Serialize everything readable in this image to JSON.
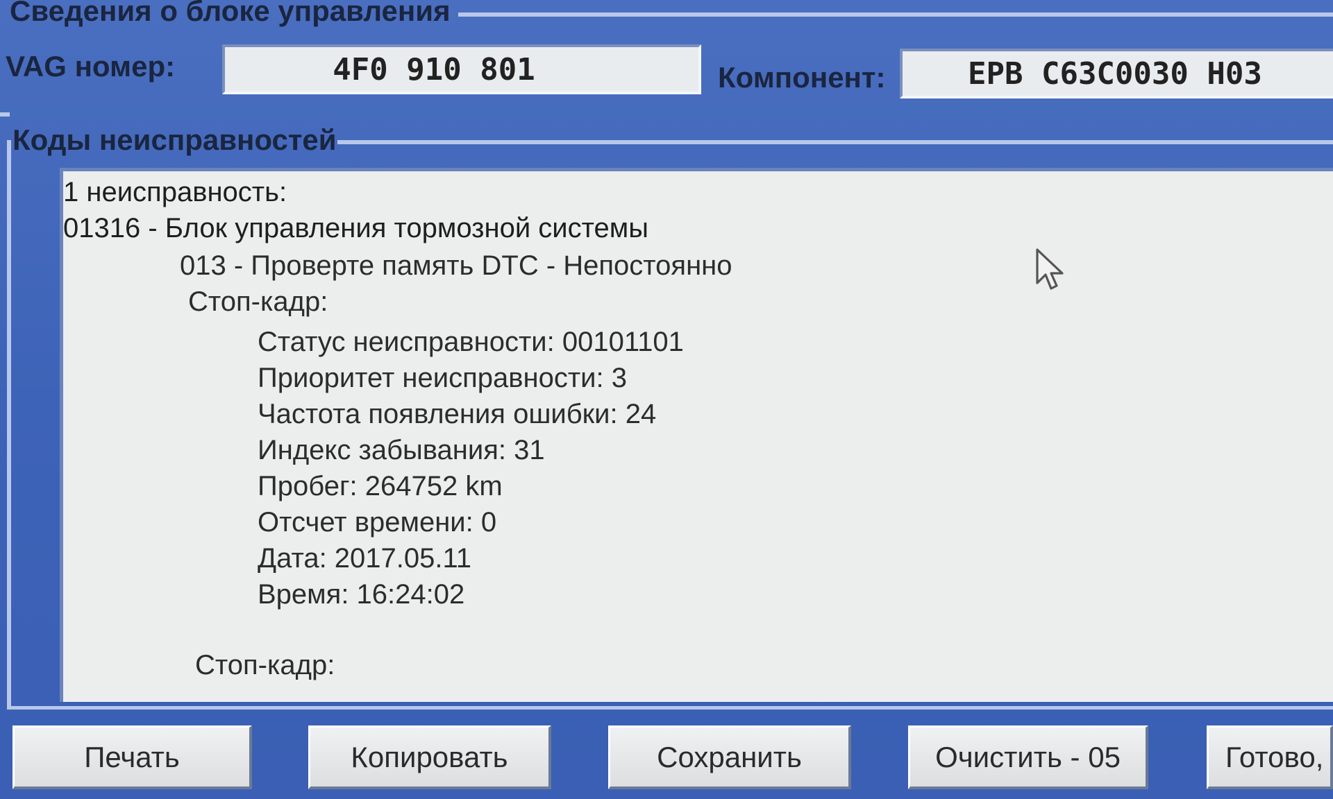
{
  "control_unit_group": {
    "title": "Сведения о блоке управления",
    "vag_label": "VAG номер:",
    "vag_value": "4F0 910 801",
    "component_label": "Компонент:",
    "component_value": "EPB  C63C0030  H03"
  },
  "fault_group": {
    "title": "Коды неисправностей",
    "lines": [
      "1 неисправность:",
      "01316 - Блок управления тормозной системы",
      "013 - Проверте память DTC - Непостоянно",
      "Стоп-кадр:",
      "Статус неисправности:  00101101",
      "Приоритет неисправности:  3",
      "Частота появления ошибки:  24",
      "Индекс забывания:  31",
      "Пробег:  264752 km",
      "Отсчет времени:  0",
      "Дата:  2017.05.11",
      "Время:  16:24:02",
      "Стоп-кадр:"
    ]
  },
  "buttons": {
    "print": "Печать",
    "copy": "Копировать",
    "save": "Сохранить",
    "clear": "Очистить - 05",
    "done": "Готово,"
  },
  "icons": {
    "cursor": "mouse-pointer-icon"
  }
}
